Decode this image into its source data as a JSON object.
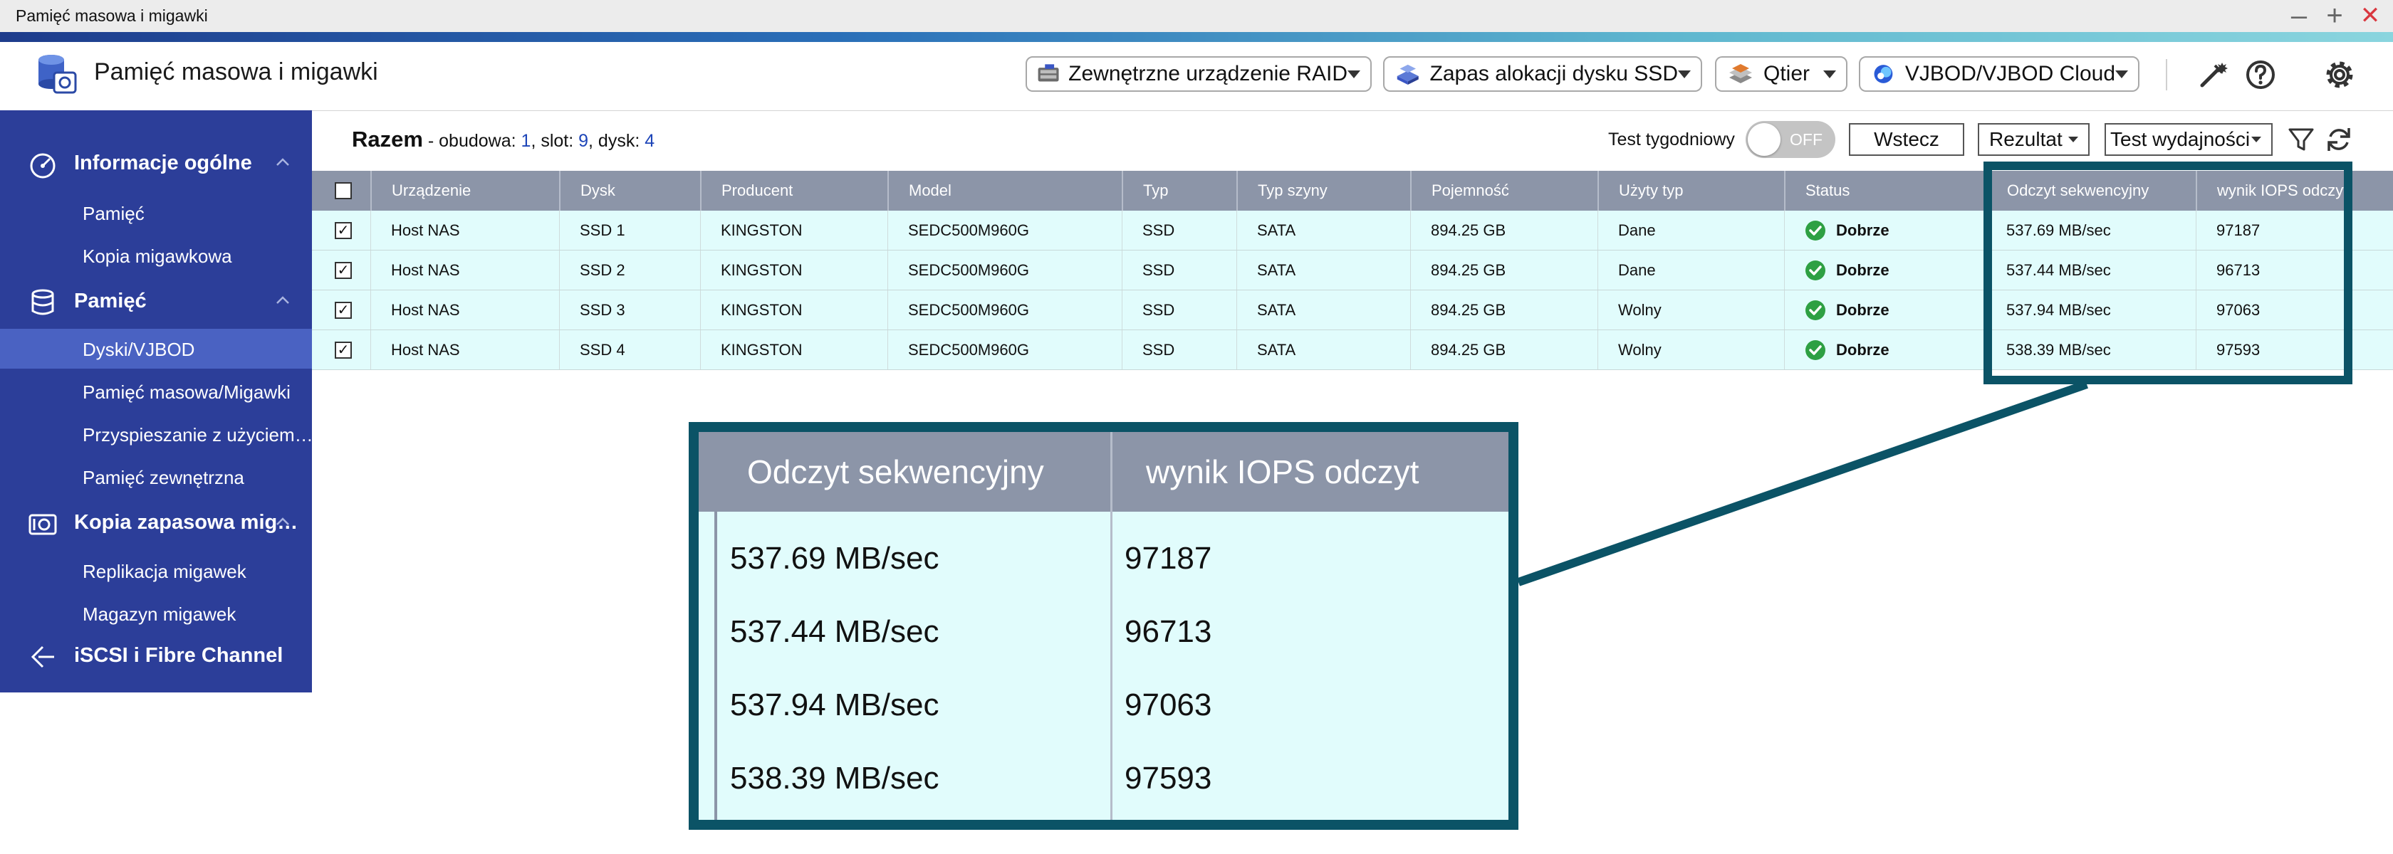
{
  "window": {
    "title": "Pamięć masowa i migawki",
    "controls": [
      "–",
      "+",
      "✕"
    ]
  },
  "header": {
    "app_title": "Pamięć masowa i migawki",
    "buttons": [
      {
        "label": "Zewnętrzne urządzenie RAID",
        "icon": "raid-enclosure-icon"
      },
      {
        "label": "Zapas alokacji dysku SSD",
        "icon": "ssd-overprovisioning-icon"
      },
      {
        "label": "Qtier",
        "icon": "qtier-icon"
      },
      {
        "label": "VJBOD/VJBOD Cloud",
        "icon": "vjbod-cloud-icon"
      }
    ],
    "icons": [
      "tools-icon",
      "help-icon",
      "settings-icon"
    ]
  },
  "sidebar": {
    "sections": [
      {
        "label": "Informacje ogólne",
        "icon": "dashboard-icon",
        "items": [
          "Pamięć",
          "Kopia migawkowa"
        ]
      },
      {
        "label": "Pamięć",
        "icon": "storage-icon",
        "items": [
          "Dyski/VJBOD",
          "Pamięć masowa/Migawki",
          "Przyspieszanie z użyciem…",
          "Pamięć zewnętrzna"
        ]
      },
      {
        "label": "Kopia zapasowa mig…",
        "icon": "snapshot-backup-icon",
        "items": [
          "Replikacja migawek",
          "Magazyn migawek"
        ]
      },
      {
        "label": "iSCSI i Fibre Channel",
        "icon": "iscsi-icon",
        "items": []
      }
    ],
    "selected": "Dyski/VJBOD"
  },
  "toolbar": {
    "summary_title": "Razem",
    "summary_sep": " - obudowa: ",
    "enclosure_count": "1",
    "slot_label": ", slot: ",
    "slot_count": "9",
    "disk_label": ", dysk: ",
    "disk_count": "4",
    "weekly_test_label": "Test tygodniowy",
    "toggle_state": "OFF",
    "back_button": "Wstecz",
    "result_button": "Rezultat",
    "perf_test_button": "Test wydajności",
    "icons": [
      "filter-icon",
      "refresh-icon"
    ]
  },
  "table": {
    "columns": [
      "Urządzenie",
      "Dysk",
      "Producent",
      "Model",
      "Typ",
      "Typ szyny",
      "Pojemność",
      "Użyty typ",
      "Status",
      "Odczyt sekwencyjny",
      "wynik IOPS odczyt"
    ],
    "rows": [
      [
        "Host NAS",
        "SSD 1",
        "KINGSTON",
        "SEDC500M960G",
        "SSD",
        "SATA",
        "894.25 GB",
        "Dane",
        "Dobrze",
        "537.69 MB/sec",
        "97187"
      ],
      [
        "Host NAS",
        "SSD 2",
        "KINGSTON",
        "SEDC500M960G",
        "SSD",
        "SATA",
        "894.25 GB",
        "Dane",
        "Dobrze",
        "537.44 MB/sec",
        "96713"
      ],
      [
        "Host NAS",
        "SSD 3",
        "KINGSTON",
        "SEDC500M960G",
        "SSD",
        "SATA",
        "894.25 GB",
        "Wolny",
        "Dobrze",
        "537.94 MB/sec",
        "97063"
      ],
      [
        "Host NAS",
        "SSD 4",
        "KINGSTON",
        "SEDC500M960G",
        "SSD",
        "SATA",
        "894.25 GB",
        "Wolny",
        "Dobrze",
        "538.39 MB/sec",
        "97593"
      ]
    ],
    "checkbox_mark": "✓"
  },
  "zoom": {
    "columns": [
      "Odczyt sekwencyjny",
      "wynik IOPS odczyt"
    ],
    "rows": [
      [
        "537.69 MB/sec",
        "97187"
      ],
      [
        "537.44 MB/sec",
        "96713"
      ],
      [
        "537.94 MB/sec",
        "97063"
      ],
      [
        "538.39 MB/sec",
        "97593"
      ]
    ]
  },
  "colors": {
    "sidebar_bg": "#2c3e99",
    "sidebar_selected": "#4a62c2",
    "table_header": "#8c95a8",
    "row_bg": "#e1fcfc",
    "highlight": "#0b5366",
    "status_ok": "#2ea043"
  }
}
